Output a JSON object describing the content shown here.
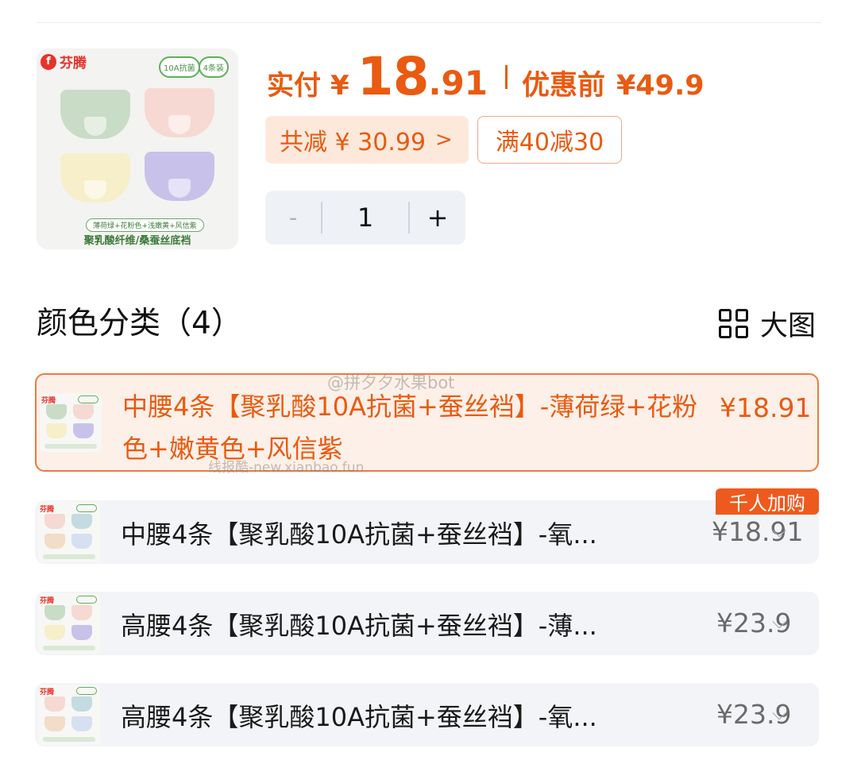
{
  "product": {
    "brand": "芬腾",
    "badges": [
      "10A抗菌",
      "4条装"
    ],
    "image_caption_colors": "薄荷绿+花粉色+浅嫩黄+风信紫",
    "image_caption_material": "聚乳酸纤维/桑蚕丝底裆"
  },
  "price": {
    "paid_label": "实付",
    "currency": "¥",
    "paid_int": "18",
    "paid_dec": ".91",
    "original_label": "优惠前",
    "original_price": "¥49.9",
    "discount_text": "共减 ¥ 30.99",
    "discount_chevron": ">",
    "coupon_text": "满40减30",
    "accent_color": "#ea5a10"
  },
  "quantity": {
    "minus": "-",
    "value": "1",
    "plus": "+"
  },
  "section": {
    "title": "颜色分类（4）",
    "big_view_label": "大图"
  },
  "options": [
    {
      "name": "中腰4条【聚乳酸10A抗菌+蚕丝裆】-薄荷绿+花粉色+嫩黄色+风信紫",
      "price": "¥18.91",
      "selected": true
    },
    {
      "name": "中腰4条【聚乳酸10A抗菌+蚕丝裆】-氧...",
      "price": "¥18.91",
      "selected": false,
      "tag": "千人加购"
    },
    {
      "name": "高腰4条【聚乳酸10A抗菌+蚕丝裆】-薄...",
      "price": "¥23.9",
      "selected": false
    },
    {
      "name": "高腰4条【聚乳酸10A抗菌+蚕丝裆】-氧...",
      "price": "¥23.9",
      "selected": false
    }
  ],
  "watermarks": {
    "weibo": "@拼夕夕水果bot",
    "site": "线报酷-new.xianbao.fun"
  },
  "icons": [
    "grid-icon",
    "chevron-down-icon",
    "chevron-right-icon"
  ]
}
